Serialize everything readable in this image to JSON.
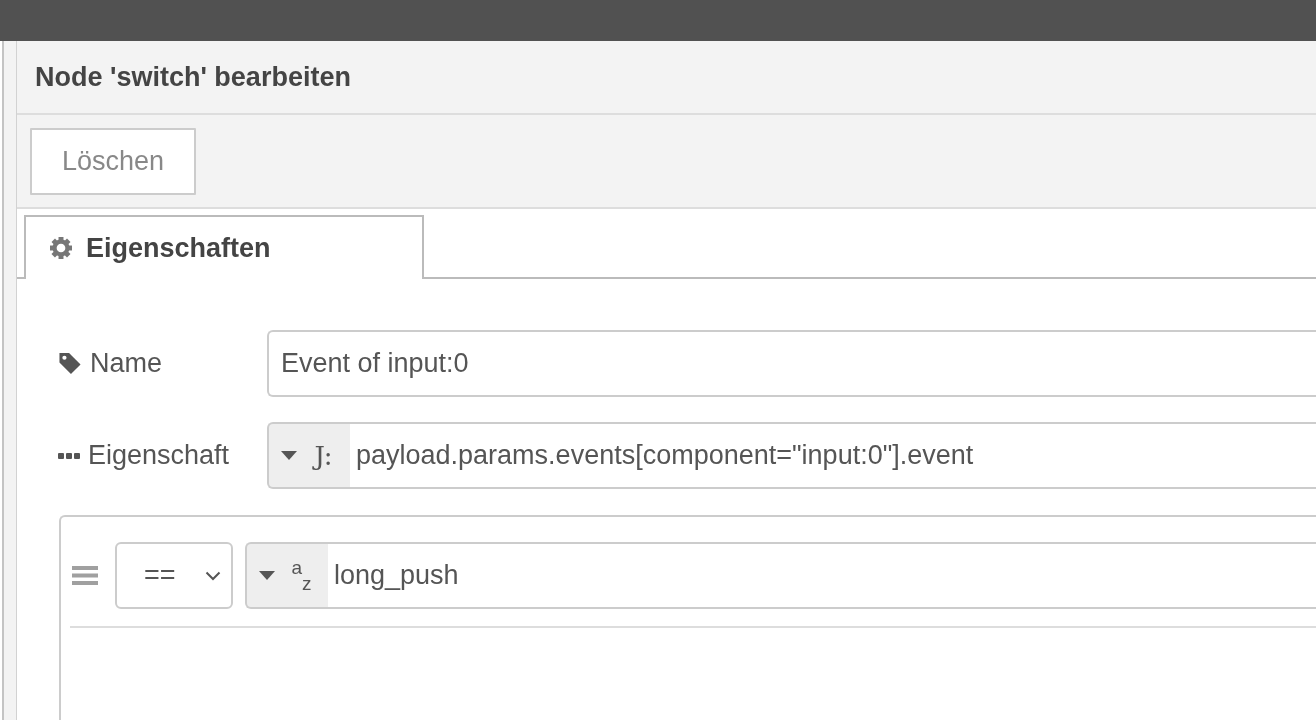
{
  "window": {
    "title": "Node 'switch' bearbeiten"
  },
  "toolbar": {
    "buttons": [
      {
        "label": "Löschen"
      }
    ]
  },
  "tabs": [
    {
      "label": "Eigenschaften",
      "selected": true
    }
  ],
  "fields": [
    {
      "kind": "text",
      "label": "Name",
      "value": "Event of input:0"
    },
    {
      "kind": "typed",
      "label": "Eigenschaft",
      "type_label": "J:",
      "value": "payload.params.events[component=\"input:0\"].event"
    }
  ],
  "rules": [
    {
      "operator": "==",
      "type_label": "$^{a}$$_{z}$",
      "value": "long_push"
    }
  ]
}
